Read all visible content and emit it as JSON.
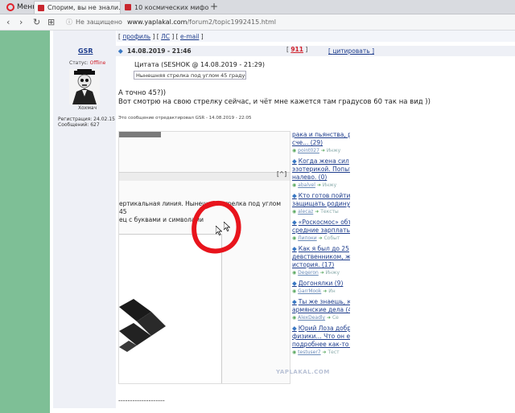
{
  "browser": {
    "menu_label": "Меню",
    "tabs": [
      {
        "title": "Спорим, вы не знали...",
        "active": true
      },
      {
        "title": "10 космических мифов, о",
        "active": false
      }
    ],
    "new_tab": "+",
    "back": "‹",
    "forward": "›",
    "reload": "↻",
    "grid": "⊞",
    "url_insecure": "Не защищено",
    "url_domain": "www.yaplakal.com",
    "url_path": "/forum2/topic1992415.html"
  },
  "profile_links": {
    "profile": "профиль",
    "pm": "ЛС",
    "email": "e-mail"
  },
  "post": {
    "username": "GSR",
    "date": "14.08.2019 - 21:46",
    "rating": "911",
    "quote_action": "цитировать",
    "status_label": "Статус:",
    "status_value": "Offline",
    "avatar_caption": "Хохмач",
    "reg_label": "Регистрация: 24.02.15",
    "msg_label": "Сообщений: 627",
    "quote_title": "Цитата (SESHOK @ 14.08.2019 - 21:29)",
    "quote_text": "Нынешняя стрелка под углом 45 градусов...",
    "body_line1": "А точно 45?))",
    "body_line2": "Вот смотрю на свою стрелку сейчас, и чёт мне кажется там градусов 60 так на вид ))",
    "edit_note": "Это сообщение отредактировал GSR - 14.08.2019 - 22:05",
    "image_up": "[^]",
    "image_text1": "ертикальная линия. Нынешняя стрелка под углом 45",
    "image_text2": "ец с буквами и символами",
    "separator": "--------------------"
  },
  "feed": [
    {
      "title": "рака и пьянства, р",
      "title2": "сче... (29)",
      "user": "point027",
      "tail": "Инжу",
      "has_icon": false
    },
    {
      "title": "Когда жена сил",
      "title2": "эзотерикой. Попыт",
      "title3": "налево. (0)",
      "user": "abalvel",
      "tail": "Инжу",
      "has_icon": true
    },
    {
      "title": "Кто готов пойти",
      "title2": "защищать родину?",
      "user": "alecaz",
      "tail": "Тексты",
      "has_icon": true
    },
    {
      "title": "«Роскосмос» обт",
      "title2": "средние зарплаты с",
      "user": "Липоки",
      "tail": "Событ",
      "has_icon": true
    },
    {
      "title": "Как я был до 25",
      "title2": "девственником, жи",
      "title3": "история. (17)",
      "user": "Degeron",
      "tail": "Инжу",
      "has_icon": true
    },
    {
      "title": "Догонялки (9)",
      "user": "GarrMook",
      "tail": "Ин",
      "has_icon": true
    },
    {
      "title": "Ты же знаешь, к",
      "title2": "армянские дела (45",
      "user": "AlexDeadly",
      "tail": "Се",
      "has_icon": true
    },
    {
      "title": "Юрий Лоза добр",
      "title2": "физики... Что он ес",
      "title3": "подробнее как-то зал",
      "user": "testuser7",
      "tail": "Тест",
      "has_icon": true
    }
  ],
  "watermark": "YAPLAKAL.COM",
  "colors": {
    "sidebar": "#7ebf96",
    "link": "#1d3c8c",
    "accent_red": "#d0202a"
  }
}
